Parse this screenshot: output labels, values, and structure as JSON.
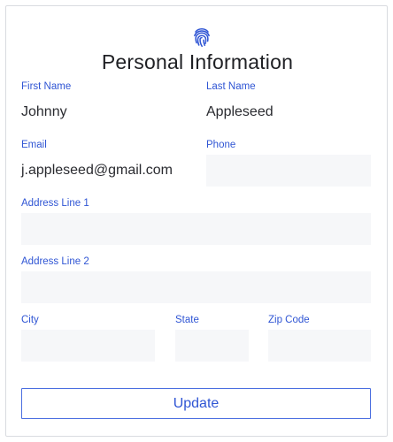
{
  "header": {
    "icon": "fingerprint-icon",
    "title": "Personal Information"
  },
  "form": {
    "first_name": {
      "label": "First Name",
      "value": "Johnny"
    },
    "last_name": {
      "label": "Last Name",
      "value": "Appleseed"
    },
    "email": {
      "label": "Email",
      "value": "j.appleseed@gmail.com"
    },
    "phone": {
      "label": "Phone",
      "value": ""
    },
    "address_line_1": {
      "label": "Address Line 1",
      "value": ""
    },
    "address_line_2": {
      "label": "Address Line 2",
      "value": ""
    },
    "city": {
      "label": "City",
      "value": ""
    },
    "state": {
      "label": "State",
      "value": ""
    },
    "zip_code": {
      "label": "Zip Code",
      "value": ""
    }
  },
  "actions": {
    "update_label": "Update"
  },
  "colors": {
    "accent": "#2f55d4",
    "field_background": "#f6f7f9",
    "border": "#d9dbe0"
  }
}
